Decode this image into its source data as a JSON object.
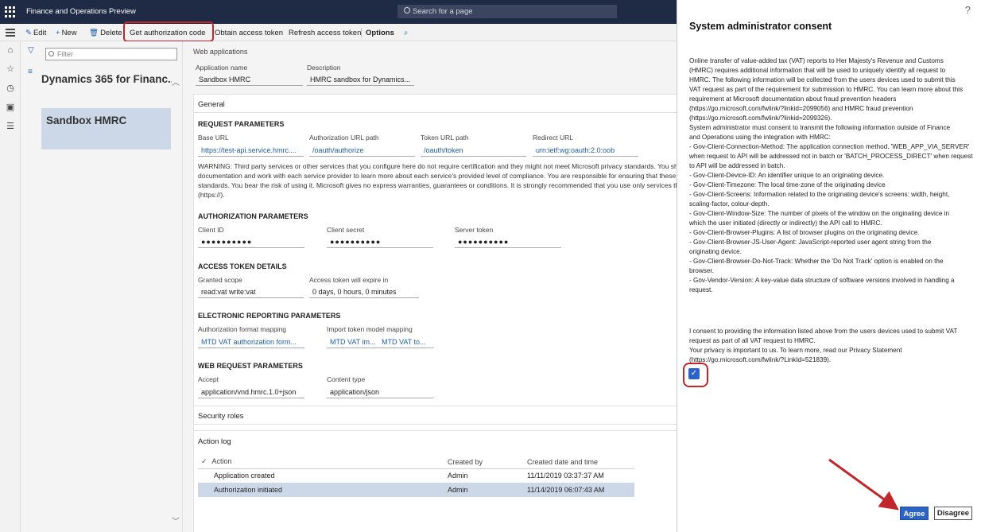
{
  "topbar": {
    "app_title": "Finance and Operations Preview",
    "search_placeholder": "Search for a page"
  },
  "actions": {
    "edit": "Edit",
    "new": "New",
    "delete": "Delete",
    "get_auth_code": "Get authorization code",
    "obtain_token": "Obtain access token",
    "refresh_token": "Refresh access token",
    "options": "Options"
  },
  "list": {
    "filter_placeholder": "Filter",
    "items": [
      "Dynamics 365 for Financ...",
      "Sandbox HMRC"
    ]
  },
  "form": {
    "page_label": "Web applications",
    "app_name_label": "Application name",
    "app_name_value": "Sandbox HMRC",
    "description_label": "Description",
    "description_value": "HMRC sandbox for Dynamics...",
    "general_tab": "General",
    "request_params": {
      "heading": "REQUEST PARAMETERS",
      "base_url_label": "Base URL",
      "base_url_value": "https://test-api.service.hmrc....",
      "auth_path_label": "Authorization URL path",
      "auth_path_value": "/oauth/authorize",
      "token_path_label": "Token URL path",
      "token_path_value": "/oauth/token",
      "redirect_label": "Redirect URL",
      "redirect_value": "urn:ietf:wg:oauth:2.0:oob",
      "warning_lines": [
        "WARNING: Third party services or other services that you configure here do not require certification and they might not meet Microsoft privacy standards. You sh",
        "documentation and work with each service provider to learn more about each service's provided level of compliance. You are responsible for ensuring that these",
        "standards. You bear the risk of using it. Microsoft gives no express warranties, guarantees or conditions. It is strongly recommended that you use only services th",
        "(https://)."
      ]
    },
    "auth_params": {
      "heading": "AUTHORIZATION PARAMETERS",
      "client_id_label": "Client ID",
      "client_id_value": "●●●●●●●●●●",
      "client_secret_label": "Client secret",
      "client_secret_value": "●●●●●●●●●●",
      "server_token_label": "Server token",
      "server_token_value": "●●●●●●●●●●"
    },
    "access_token": {
      "heading": "ACCESS TOKEN DETAILS",
      "scope_label": "Granted scope",
      "scope_value": "read:vat write:vat",
      "expire_label": "Access token will expire in",
      "expire_value": "0 days, 0 hours, 0 minutes"
    },
    "er_params": {
      "heading": "ELECTRONIC REPORTING PARAMETERS",
      "format_label": "Authorization format mapping",
      "format_value": "MTD VAT authorization form...",
      "import_label": "Import token model mapping",
      "import_value_1": "MTD VAT im...",
      "import_value_2": "MTD VAT to..."
    },
    "web_request": {
      "heading": "WEB REQUEST PARAMETERS",
      "accept_label": "Accept",
      "accept_value": "application/vnd.hmrc.1.0+json",
      "content_type_label": "Content type",
      "content_type_value": "application/json"
    },
    "security_roles_tab": "Security roles",
    "action_log_tab": "Action log",
    "action_log": {
      "columns": [
        "Action",
        "Created by",
        "Created date and time"
      ],
      "rows": [
        [
          "Application created",
          "Admin",
          "11/11/2019 03:37:37 AM"
        ],
        [
          "Authorization initiated",
          "Admin",
          "11/14/2019 06:07:43 AM"
        ]
      ]
    }
  },
  "dialog": {
    "help": "?",
    "title": "System administrator consent",
    "body_lines": [
      "Online transfer of value-added tax (VAT) reports to Her Majesty's Revenue and Customs",
      "(HMRC) requires additional information that will be used to uniquely identify all request to",
      "HMRC. The following information will be collected from the users devices used to submit this",
      "VAT request as part of the requirement for submission to HMRC. You can learn more about this",
      "requirement at Microsoft documentation about fraud prevention headers",
      "(https://go.microsoft.com/fwlink/?linkid=2099056) and HMRC fraud prevention",
      "(https://go.microsoft.com/fwlink/?linkid=2099326).",
      "System administrator must consent to transmit the following information outside of Finance",
      "and Operations using the integration with HMRC:",
      "- Gov-Client-Connection-Method: The application connection method. 'WEB_APP_VIA_SERVER'",
      "when request to API will be addressed not in batch or 'BATCH_PROCESS_DIRECT' when request",
      "to API will be addressed in batch.",
      "- Gov-Client-Device-ID: An identifier unique to an originating device.",
      "- Gov-Client-Timezone: The local time-zone of the originating device",
      "- Gov-Client-Screens: Information related to the originating device's screens: width, height,",
      "scaling-factor, colour-depth.",
      "- Gov-Client-Window-Size: The number of pixels of the window on the originating device in",
      "which the user initiated (directly or indirectly) the API call to HMRC.",
      "- Gov-Client-Browser-Plugins: A list of browser plugins on the originating device.",
      "- Gov-Client-Browser-JS-User-Agent: JavaScript-reported user agent string from the",
      "originating device.",
      "- Gov-Client-Browser-Do-Not-Track: Whether the 'Do Not Track' option is enabled on the",
      "browser.",
      "- Gov-Vendor-Version: A key-value data structure of software versions involved in handling a",
      "request."
    ],
    "consent_lines": [
      "I consent to providing the information listed above from the users devices used to submit VAT",
      "request as part of all VAT request to HMRC.",
      "Your privacy is important to us. To learn more, read our Privacy Statement",
      "(https://go.microsoft.com/fwlink/?LinkId=521839)."
    ],
    "consent_checked": true,
    "agree": "Agree",
    "disagree": "Disagree"
  },
  "colors": {
    "accent": "#2b63c6",
    "highlight": "#c0272d",
    "nav": "#1f2a44"
  }
}
